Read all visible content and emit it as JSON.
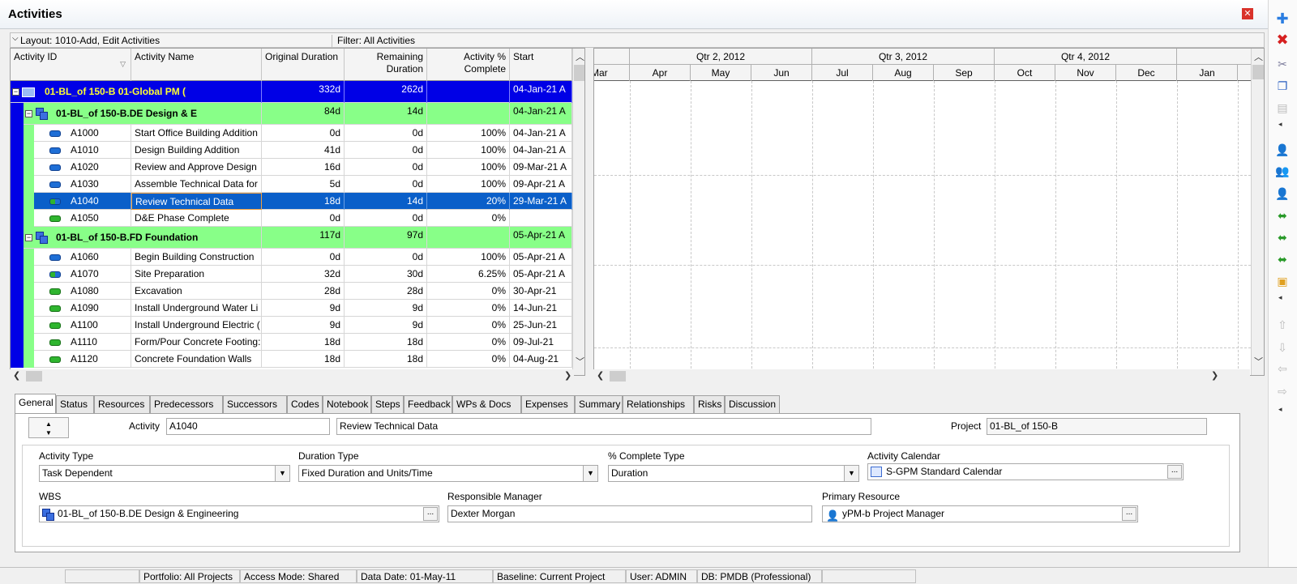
{
  "window": {
    "title": "Activities"
  },
  "toolbar": {
    "layout_label": "Layout: 1010-Add, Edit Activities",
    "filter_label": "Filter: All Activities"
  },
  "columns": {
    "activity_id": "Activity ID",
    "activity_name": "Activity Name",
    "original_duration": "Original Duration",
    "remaining_duration_l1": "Remaining",
    "remaining_duration_l2": "Duration",
    "pct_complete_l1": "Activity %",
    "pct_complete_l2": "Complete",
    "start": "Start"
  },
  "rows": [
    {
      "type": "wbs-top",
      "id": "01-BL_of 150-B",
      "name": "01-Global PM (",
      "orig": "332d",
      "rem": "262d",
      "pct": "",
      "start": "04-Jan-21 A"
    },
    {
      "type": "wbs-green",
      "id": "01-BL_of 150-B.DE",
      "name": "Design & E",
      "orig": "84d",
      "rem": "14d",
      "pct": "",
      "start": "04-Jan-21 A"
    },
    {
      "type": "act",
      "icon": "blue",
      "id": "A1000",
      "name": "Start Office Building Addition",
      "orig": "0d",
      "rem": "0d",
      "pct": "100%",
      "start": "04-Jan-21 A"
    },
    {
      "type": "act",
      "icon": "blue",
      "id": "A1010",
      "name": "Design Building Addition",
      "orig": "41d",
      "rem": "0d",
      "pct": "100%",
      "start": "04-Jan-21 A"
    },
    {
      "type": "act",
      "icon": "blue",
      "id": "A1020",
      "name": "Review and Approve Design",
      "orig": "16d",
      "rem": "0d",
      "pct": "100%",
      "start": "09-Mar-21 A"
    },
    {
      "type": "act",
      "icon": "blue",
      "id": "A1030",
      "name": "Assemble Technical Data for",
      "orig": "5d",
      "rem": "0d",
      "pct": "100%",
      "start": "09-Apr-21 A"
    },
    {
      "type": "selected",
      "icon": "mixed",
      "id": "A1040",
      "name": "Review Technical Data",
      "orig": "18d",
      "rem": "14d",
      "pct": "20%",
      "start": "29-Mar-21 A"
    },
    {
      "type": "act",
      "icon": "green",
      "id": "A1050",
      "name": "D&E Phase Complete",
      "orig": "0d",
      "rem": "0d",
      "pct": "0%",
      "start": ""
    },
    {
      "type": "wbs-green",
      "id": "01-BL_of 150-B.FD",
      "name": "Foundation",
      "orig": "117d",
      "rem": "97d",
      "pct": "",
      "start": "05-Apr-21 A"
    },
    {
      "type": "act",
      "icon": "blue",
      "id": "A1060",
      "name": "Begin Building Construction",
      "orig": "0d",
      "rem": "0d",
      "pct": "100%",
      "start": "05-Apr-21 A"
    },
    {
      "type": "act",
      "icon": "mixed",
      "id": "A1070",
      "name": "Site Preparation",
      "orig": "32d",
      "rem": "30d",
      "pct": "6.25%",
      "start": "05-Apr-21 A"
    },
    {
      "type": "act",
      "icon": "green",
      "id": "A1080",
      "name": "Excavation",
      "orig": "28d",
      "rem": "28d",
      "pct": "0%",
      "start": "30-Apr-21"
    },
    {
      "type": "act",
      "icon": "green",
      "id": "A1090",
      "name": "Install Underground Water Li",
      "orig": "9d",
      "rem": "9d",
      "pct": "0%",
      "start": "14-Jun-21"
    },
    {
      "type": "act",
      "icon": "green",
      "id": "A1100",
      "name": "Install Underground Electric (",
      "orig": "9d",
      "rem": "9d",
      "pct": "0%",
      "start": "25-Jun-21"
    },
    {
      "type": "act",
      "icon": "green",
      "id": "A1110",
      "name": "Form/Pour Concrete Footing:",
      "orig": "18d",
      "rem": "18d",
      "pct": "0%",
      "start": "09-Jul-21"
    },
    {
      "type": "act",
      "icon": "green",
      "id": "A1120",
      "name": "Concrete Foundation Walls",
      "orig": "18d",
      "rem": "18d",
      "pct": "0%",
      "start": "04-Aug-21"
    }
  ],
  "gantt": {
    "quarters": [
      "Qtr 2, 2012",
      "Qtr 3, 2012",
      "Qtr 4, 2012"
    ],
    "months": [
      "Mar",
      "Apr",
      "May",
      "Jun",
      "Jul",
      "Aug",
      "Sep",
      "Oct",
      "Nov",
      "Dec",
      "Jan"
    ]
  },
  "tabs": [
    "General",
    "Status",
    "Resources",
    "Predecessors",
    "Successors",
    "Codes",
    "Notebook",
    "Steps",
    "Feedback",
    "WPs & Docs",
    "Expenses",
    "Summary",
    "Relationships",
    "Risks",
    "Discussion"
  ],
  "detail": {
    "activity_label": "Activity",
    "activity_id": "A1040",
    "activity_name": "Review Technical Data",
    "project_label": "Project",
    "project_value": "01-BL_of 150-B",
    "activity_type_label": "Activity Type",
    "activity_type_value": "Task Dependent",
    "duration_type_label": "Duration Type",
    "duration_type_value": "Fixed Duration and Units/Time",
    "pct_type_label": "% Complete Type",
    "pct_type_value": "Duration",
    "calendar_label": "Activity Calendar",
    "calendar_value": "S-GPM Standard Calendar",
    "wbs_label": "WBS",
    "wbs_value": "01-BL_of 150-B.DE  Design & Engineering",
    "manager_label": "Responsible Manager",
    "manager_value": "Dexter Morgan",
    "resource_label": "Primary Resource",
    "resource_value": "yPM-b  Project Manager",
    "ellipsis": "..."
  },
  "status_bar": {
    "portfolio": "Portfolio: All Projects",
    "access": "Access Mode: Shared",
    "data_date": "Data Date: 01-May-11",
    "baseline": "Baseline: Current Project",
    "user": "User: ADMIN",
    "db": "DB: PMDB (Professional)"
  },
  "colors": {
    "wbs_top": "#0000e6",
    "wbs_green": "#88ff88",
    "selected": "#0a5fc9"
  }
}
